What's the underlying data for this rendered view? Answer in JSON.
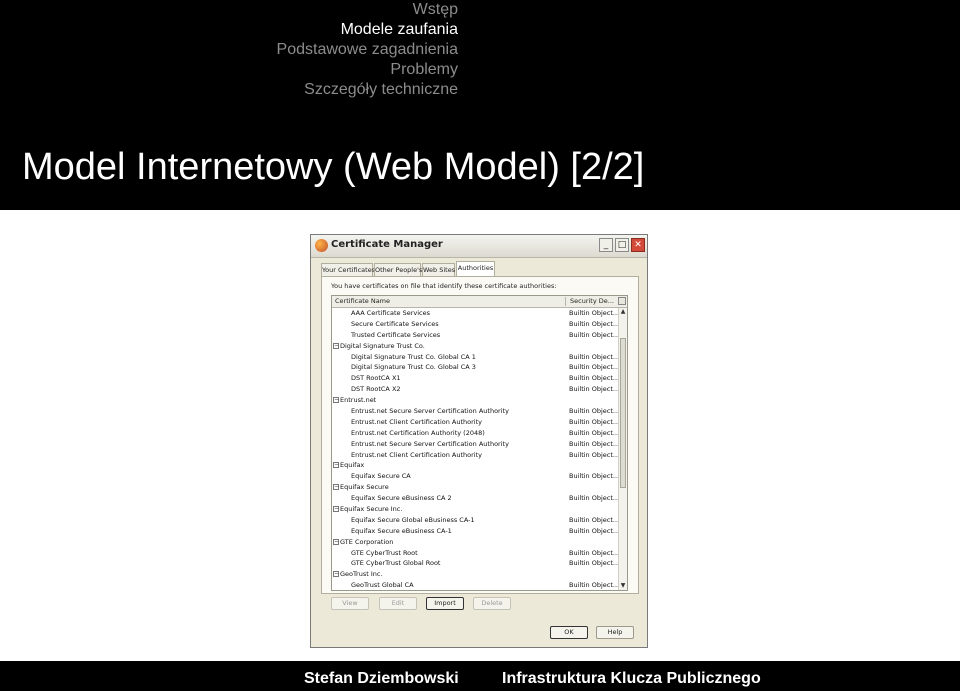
{
  "header": {
    "nav": [
      {
        "label": "Wstęp",
        "active": false
      },
      {
        "label": "Modele zaufania",
        "active": true
      },
      {
        "label": "Podstawowe zagadnienia",
        "active": false
      },
      {
        "label": "Problemy",
        "active": false
      },
      {
        "label": "Szczegóły techniczne",
        "active": false
      }
    ],
    "title": "Model Internetowy (Web Model) [2/2]"
  },
  "window": {
    "title": "Certificate Manager",
    "buttons": {
      "minimize": "_",
      "maximize": "□",
      "close": "✕"
    },
    "tabs": [
      {
        "label": "Your Certificates",
        "active": false
      },
      {
        "label": "Other People's",
        "active": false
      },
      {
        "label": "Web Sites",
        "active": false
      },
      {
        "label": "Authorities",
        "active": true
      }
    ],
    "intro": "You have certificates on file that identify these certificate authorities:",
    "columns": {
      "name": "Certificate Name",
      "security": "Security De..."
    },
    "rows": [
      {
        "type": "child",
        "name": "AAA Certificate Services",
        "security": "Builtin Object..."
      },
      {
        "type": "child",
        "name": "Secure Certificate Services",
        "security": "Builtin Object..."
      },
      {
        "type": "child",
        "name": "Trusted Certificate Services",
        "security": "Builtin Object..."
      },
      {
        "type": "group",
        "name": "Digital Signature Trust Co.",
        "security": ""
      },
      {
        "type": "child",
        "name": "Digital Signature Trust Co. Global CA 1",
        "security": "Builtin Object..."
      },
      {
        "type": "child",
        "name": "Digital Signature Trust Co. Global CA 3",
        "security": "Builtin Object..."
      },
      {
        "type": "child",
        "name": "DST RootCA X1",
        "security": "Builtin Object..."
      },
      {
        "type": "child",
        "name": "DST RootCA X2",
        "security": "Builtin Object..."
      },
      {
        "type": "group",
        "name": "Entrust.net",
        "security": ""
      },
      {
        "type": "child",
        "name": "Entrust.net Secure Server Certification Authority",
        "security": "Builtin Object..."
      },
      {
        "type": "child",
        "name": "Entrust.net Client Certification Authority",
        "security": "Builtin Object..."
      },
      {
        "type": "child",
        "name": "Entrust.net Certification Authority (2048)",
        "security": "Builtin Object..."
      },
      {
        "type": "child",
        "name": "Entrust.net Secure Server Certification Authority",
        "security": "Builtin Object..."
      },
      {
        "type": "child",
        "name": "Entrust.net Client Certification Authority",
        "security": "Builtin Object..."
      },
      {
        "type": "group",
        "name": "Equifax",
        "security": ""
      },
      {
        "type": "child",
        "name": "Equifax Secure CA",
        "security": "Builtin Object..."
      },
      {
        "type": "group",
        "name": "Equifax Secure",
        "security": ""
      },
      {
        "type": "child",
        "name": "Equifax Secure eBusiness CA 2",
        "security": "Builtin Object..."
      },
      {
        "type": "group",
        "name": "Equifax Secure Inc.",
        "security": ""
      },
      {
        "type": "child",
        "name": "Equifax Secure Global eBusiness CA-1",
        "security": "Builtin Object..."
      },
      {
        "type": "child",
        "name": "Equifax Secure eBusiness CA-1",
        "security": "Builtin Object..."
      },
      {
        "type": "group",
        "name": "GTE Corporation",
        "security": ""
      },
      {
        "type": "child",
        "name": "GTE CyberTrust Root",
        "security": "Builtin Object..."
      },
      {
        "type": "child",
        "name": "GTE CyberTrust Global Root",
        "security": "Builtin Object..."
      },
      {
        "type": "group",
        "name": "GeoTrust Inc.",
        "security": ""
      },
      {
        "type": "child",
        "name": "GeoTrust Global CA",
        "security": "Builtin Object..."
      }
    ],
    "actions": {
      "view": "View",
      "edit": "Edit",
      "import": "Import",
      "delete": "Delete"
    },
    "dialog": {
      "ok": "OK",
      "help": "Help"
    }
  },
  "footer": {
    "author": "Stefan Dziembowski",
    "course": "Infrastruktura Klucza Publicznego"
  }
}
